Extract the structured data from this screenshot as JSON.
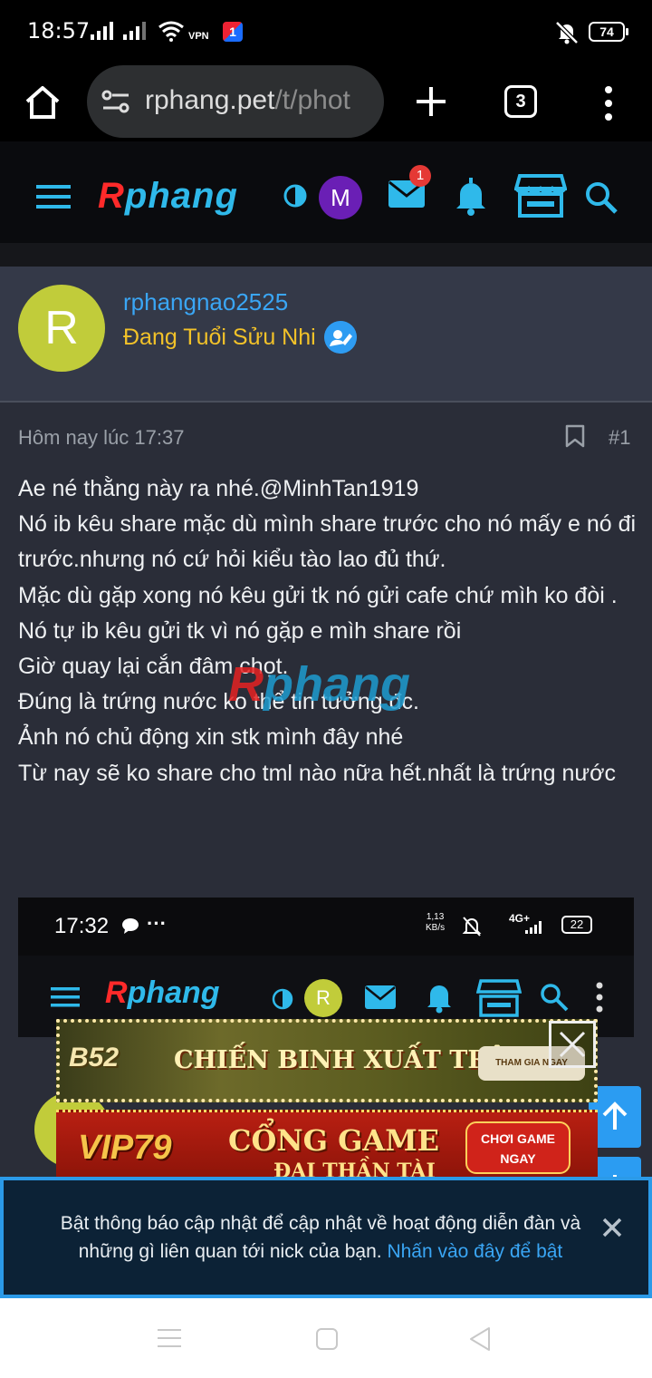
{
  "status_bar": {
    "time": "18:57",
    "vpn_label": "VPN",
    "app_badge": "1",
    "battery": "74",
    "icons": [
      "signal-icon",
      "signal-icon",
      "wifi-icon",
      "vpn-icon",
      "app-icon",
      "mute-icon",
      "battery-icon"
    ]
  },
  "browser": {
    "url_host": "rphang.pet",
    "url_path": "/t/phot",
    "tab_count": "3",
    "icons": [
      "home-icon",
      "site-settings-icon",
      "new-tab-icon",
      "tab-switcher-icon",
      "more-icon"
    ]
  },
  "site_header": {
    "logo_r": "R",
    "logo_rest": "phang",
    "avatar_letter": "M",
    "inbox_badge": "1",
    "accent": "#2fb9ea",
    "icons": [
      "hamburger-icon",
      "theme-toggle-icon",
      "mail-icon",
      "bell-icon",
      "store-icon",
      "search-icon"
    ]
  },
  "post": {
    "avatar_letter": "R",
    "username": "rphangnao2525",
    "user_title": "Đang Tuổi Sửu Nhi",
    "timestamp": "Hôm nay lúc 17:37",
    "post_number": "#1",
    "lines": [
      "Ae né thằng này ra nhé.@MinhTan1919",
      "Nó ib kêu share mặc dù mình share trước cho nó mấy e nó đi trước.nhưng nó cứ hỏi kiểu tào lao đủ thứ.",
      "Mặc dù gặp xong nó kêu gửi tk nó gửi cafe chứ mìh ko đòi .",
      "Nó tự ib kêu gửi tk vì nó gặp e mìh share rồi",
      "Giờ quay lại cắn đâm chọt.",
      "Đúng là trứng nước ko thể tin tưởng đc.",
      "Ảnh nó chủ động xin stk mình đây nhé",
      "Từ nay sẽ ko share cho tml nào nữa hết.nhất là trứng nước"
    ],
    "watermark_r": "R",
    "watermark_rest": "phang"
  },
  "embedded_screenshot": {
    "time": "17:32",
    "dots": "···",
    "speed_value": "1,13",
    "speed_unit": "KB/s",
    "network": "4G+",
    "battery": "22",
    "logo_r": "R",
    "logo_rest": "phang",
    "avatar_letter": "R"
  },
  "ads": [
    {
      "logo": "B52",
      "text": "CHIẾN BINH XUẤT TRẬN",
      "cta": "THAM GIA NGAY"
    },
    {
      "logo": "VIP79",
      "text": "CỔNG GAME",
      "text2": "ĐẠI THẦN TÀI",
      "cta_line1": "CHƠI GAME",
      "cta_line2": "NGAY"
    }
  ],
  "notice": {
    "text": "Bật thông báo cập nhật để cập nhật về hoạt động diễn đàn và những gì liên quan tới nick của bạn.",
    "link": "Nhấn vào đây để bật"
  },
  "nav": {
    "icons": [
      "recents-icon",
      "home-nav-icon",
      "back-icon"
    ]
  }
}
